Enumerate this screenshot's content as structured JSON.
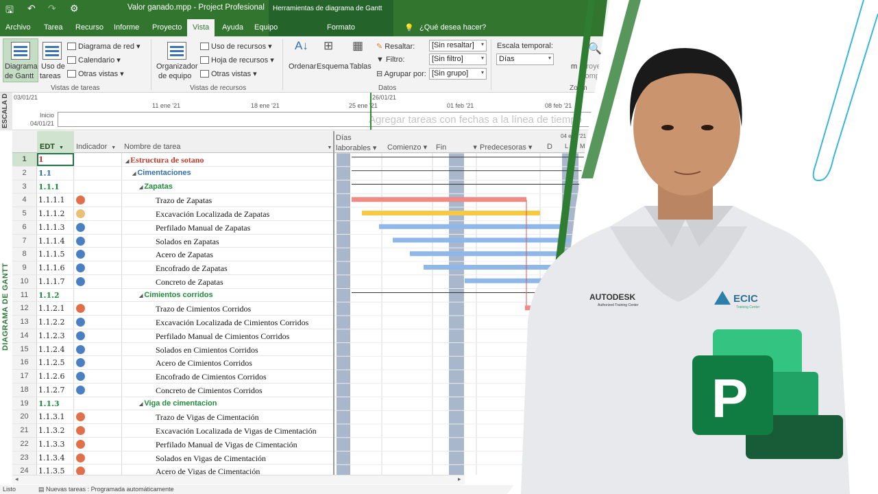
{
  "titlebar": {
    "title": "Valor ganado.mpp  -  Project Profesional",
    "context_title": "Herramientas de diagrama de Gantt"
  },
  "tabs": [
    "Archivo",
    "Tarea",
    "Recurso",
    "Informe",
    "Proyecto",
    "Vista",
    "Ayuda",
    "Equipo"
  ],
  "active_tab": "Vista",
  "context_tab": "Formato",
  "tell_me": "¿Qué desea hacer?",
  "ribbon": {
    "task_views": {
      "gantt_1": "Diagrama",
      "gantt_2": "de Gantt",
      "usage_1": "Uso de",
      "usage_2": "tareas",
      "network": "Diagrama de red",
      "calendar": "Calendario",
      "other": "Otras vistas",
      "group_label": "Vistas de tareas"
    },
    "resource_views": {
      "team_1": "Organizador",
      "team_2": "de equipo",
      "usage": "Uso de recursos",
      "sheet": "Hoja de recursos",
      "other": "Otras vistas",
      "group_label": "Vistas de recursos"
    },
    "data": {
      "sort": "Ordenar",
      "outline": "Esquema",
      "tables": "Tablas",
      "highlight_label": "Resaltar:",
      "highlight_value": "[Sin resaltar]",
      "filter_label": "Filtro:",
      "filter_value": "[Sin filtro]",
      "group_label_field": "Agrupar por:",
      "group_value": "[Sin grupo]",
      "group_label": "Datos"
    },
    "zoom": {
      "timescale_label": "Escala temporal:",
      "timescale_value": "Días",
      "zoom_partial": "m",
      "project_1": "Proyecto",
      "project_2": "complet",
      "group_label": "Zoom"
    }
  },
  "timeline": {
    "side_label": "ESCALA D",
    "start_date_top": "03/01/21",
    "dates": [
      "11 ene '21",
      "18 ene '21",
      "25 ene '21",
      "01 feb '21",
      "08 feb '21"
    ],
    "today_label": "26/01/21",
    "start_word": "Inicio",
    "start_date": "04/01/21",
    "hint": "Agregar tareas con fechas a la línea de tiempo"
  },
  "gantt_side_label": "DIAGRAMA DE GANTT",
  "columns": {
    "edt": "EDT",
    "indicator": "Indicador",
    "name": "Nombre de tarea",
    "days_1": "Días",
    "days_2": "laborables",
    "start": "Comienzo",
    "finish": "Fin",
    "predecessors": "Predecesoras",
    "d": "D",
    "week": "04 ene '21",
    "day_l": "L",
    "day_m": "M"
  },
  "rows": [
    {
      "n": "1",
      "edt": "1",
      "name": "Estructura de sotano",
      "level": 0,
      "summary": true,
      "ind": ""
    },
    {
      "n": "2",
      "edt": "1.1",
      "name": "Cimentaciones",
      "level": 1,
      "summary": true,
      "ind": ""
    },
    {
      "n": "3",
      "edt": "1.1.1",
      "name": "Zapatas",
      "level": 2,
      "summary": true,
      "ind": ""
    },
    {
      "n": "4",
      "edt": "1.1.1.1",
      "name": "Trazo de Zapatas",
      "level": 3,
      "summary": false,
      "ind": "#e0704a"
    },
    {
      "n": "5",
      "edt": "1.1.1.2",
      "name": "Excavación Localizada de Zapatas",
      "level": 3,
      "summary": false,
      "ind": "#e8c176"
    },
    {
      "n": "6",
      "edt": "1.1.1.3",
      "name": "Perfilado Manual de Zapatas",
      "level": 3,
      "summary": false,
      "ind": "#4a7fc2"
    },
    {
      "n": "7",
      "edt": "1.1.1.4",
      "name": "Solados en Zapatas",
      "level": 3,
      "summary": false,
      "ind": "#4a7fc2"
    },
    {
      "n": "8",
      "edt": "1.1.1.5",
      "name": "Acero de Zapatas",
      "level": 3,
      "summary": false,
      "ind": "#4a7fc2"
    },
    {
      "n": "9",
      "edt": "1.1.1.6",
      "name": "Encofrado de Zapatas",
      "level": 3,
      "summary": false,
      "ind": "#4a7fc2"
    },
    {
      "n": "10",
      "edt": "1.1.1.7",
      "name": "Concreto de Zapatas",
      "level": 3,
      "summary": false,
      "ind": "#4a7fc2"
    },
    {
      "n": "11",
      "edt": "1.1.2",
      "name": "Cimientos corridos",
      "level": 2,
      "summary": true,
      "ind": ""
    },
    {
      "n": "12",
      "edt": "1.1.2.1",
      "name": "Trazo de Cimientos Corridos",
      "level": 3,
      "summary": false,
      "ind": "#e0704a"
    },
    {
      "n": "13",
      "edt": "1.1.2.2",
      "name": "Excavación Localizada de Cimientos Corridos",
      "level": 3,
      "summary": false,
      "ind": "#4a7fc2"
    },
    {
      "n": "14",
      "edt": "1.1.2.3",
      "name": "Perfilado Manual de Cimientos Corridos",
      "level": 3,
      "summary": false,
      "ind": "#4a7fc2"
    },
    {
      "n": "15",
      "edt": "1.1.2.4",
      "name": "Solados en Cimientos Corridos",
      "level": 3,
      "summary": false,
      "ind": "#4a7fc2"
    },
    {
      "n": "16",
      "edt": "1.1.2.5",
      "name": "Acero de Cimientos Corridos",
      "level": 3,
      "summary": false,
      "ind": "#4a7fc2"
    },
    {
      "n": "17",
      "edt": "1.1.2.6",
      "name": "Encofrado de Cimientos Corridos",
      "level": 3,
      "summary": false,
      "ind": "#4a7fc2"
    },
    {
      "n": "18",
      "edt": "1.1.2.7",
      "name": "Concreto de Cimientos Corridos",
      "level": 3,
      "summary": false,
      "ind": "#4a7fc2"
    },
    {
      "n": "19",
      "edt": "1.1.3",
      "name": "Viga de cimentacion",
      "level": 2,
      "summary": true,
      "ind": ""
    },
    {
      "n": "20",
      "edt": "1.1.3.1",
      "name": "Trazo de Vigas de Cimentación",
      "level": 3,
      "summary": false,
      "ind": "#e0704a"
    },
    {
      "n": "21",
      "edt": "1.1.3.2",
      "name": "Excavación Localizada de Vigas de Cimentación",
      "level": 3,
      "summary": false,
      "ind": "#e0704a"
    },
    {
      "n": "22",
      "edt": "1.1.3.3",
      "name": "Perfilado Manual de Vigas de Cimentación",
      "level": 3,
      "summary": false,
      "ind": "#e0704a"
    },
    {
      "n": "23",
      "edt": "1.1.3.4",
      "name": "Solados en Vigas de Cimentación",
      "level": 3,
      "summary": false,
      "ind": "#e0704a"
    },
    {
      "n": "24",
      "edt": "1.1.3.5",
      "name": "Acero de Vigas de Cimentación",
      "level": 3,
      "summary": false,
      "ind": "#e0704a"
    }
  ],
  "status": {
    "ready": "Listo",
    "new_tasks": "Nuevas tareas : Programada automáticamente"
  },
  "badges": {
    "autodesk": "AUTODESK",
    "autodesk_sub": "Authorized Training Center",
    "ecic": "ECIC",
    "ecic_sub": "Training Center"
  },
  "colors": {
    "brand_green": "#31752f",
    "summary_red": "#c0392b",
    "summary_blue": "#2f6fb5",
    "summary_green": "#1e8c3a",
    "bar_red": "#f08a86",
    "bar_yellow": "#f7c843",
    "bar_blue": "#8fb8e8"
  }
}
